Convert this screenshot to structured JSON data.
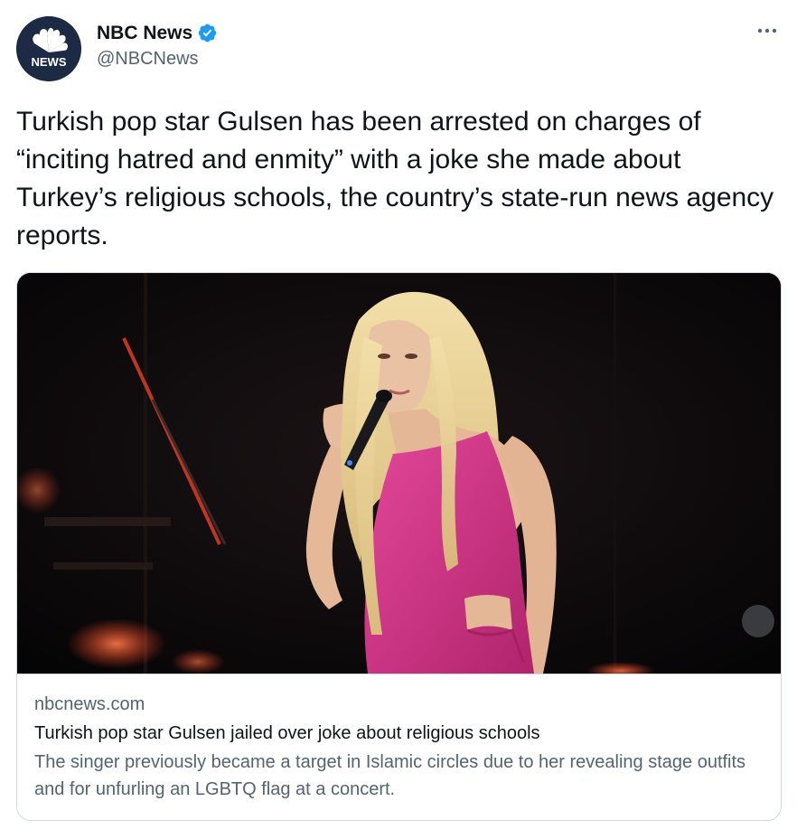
{
  "account": {
    "name": "NBC News",
    "handle": "@NBCNews",
    "avatar_text": "NEWS",
    "verified": true
  },
  "icons": {
    "verified": "verified-badge-icon",
    "more": "more-options-icon"
  },
  "colors": {
    "verified_blue": "#1d9bf0",
    "text_primary": "#0f1419",
    "text_secondary": "#536471",
    "border": "#cfd9de"
  },
  "tweet": {
    "text": "Turkish pop star Gulsen has been arrested on charges of “inciting hatred and enmity” with a joke she made about Turkey’s religious schools, the country’s state-run news agency reports."
  },
  "link_card": {
    "domain": "nbcnews.com",
    "title": "Turkish pop star Gulsen jailed over joke about religious schools",
    "description": "The singer previously became a target in Islamic circles due to her revealing stage outfits and for unfurling an LGBTQ flag at a concert."
  }
}
